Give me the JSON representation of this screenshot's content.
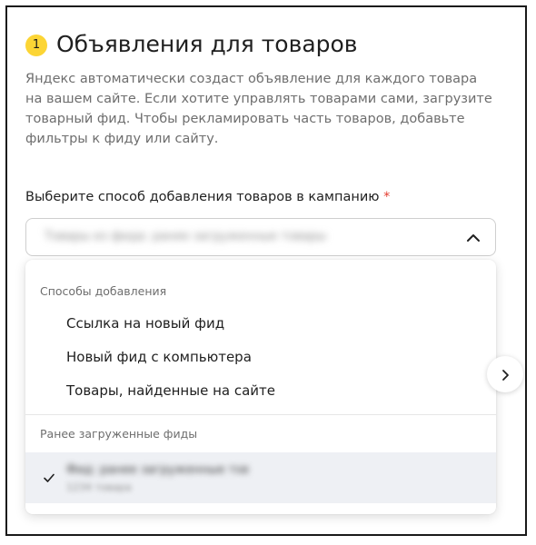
{
  "section": {
    "step_number": "1",
    "title": "Объявления для товаров",
    "description": "Яндекс автоматически создаст объявление для каждого товара на вашем сайте. Если хотите управлять товарами сами, загрузите товарный фид. Чтобы рекламировать часть товаров, добавьте фильтры к фиду или сайту."
  },
  "field": {
    "label": "Выберите способ добавления товаров в кампанию",
    "required_mark": "*",
    "selected_value": "Товары из фида: ранее загруженные товары"
  },
  "dropdown": {
    "group_methods": "Способы добавления",
    "options": [
      {
        "label": "Ссылка на новый фид"
      },
      {
        "label": "Новый фид с компьютера"
      },
      {
        "label": "Товары, найденные на сайте"
      }
    ],
    "group_feeds": "Ранее загруженные фиды",
    "feeds": [
      {
        "title": "Фид: ранее загруженные товары",
        "subtitle": "1234 товара",
        "selected": true
      }
    ]
  },
  "colors": {
    "badge": "#fcd535",
    "required": "#e43d30",
    "selected_row": "#eef0f4"
  },
  "icons": {
    "select_toggle": "chevron-up-icon",
    "selected_marker": "check-icon",
    "side_nav": "chevron-right-icon"
  }
}
